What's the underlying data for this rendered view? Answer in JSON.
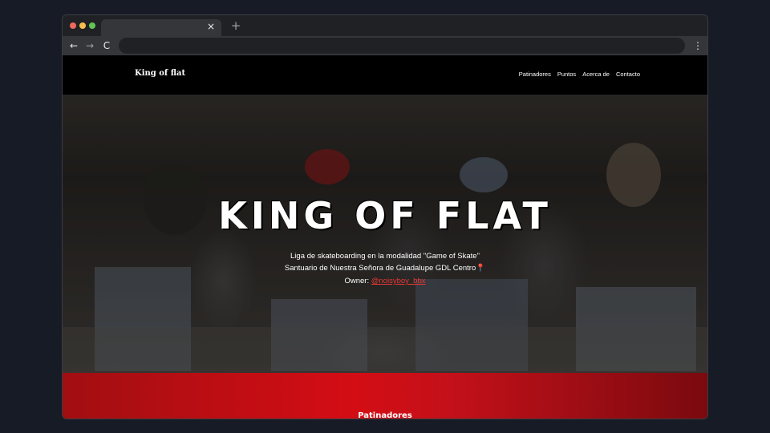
{
  "browser": {
    "tab_close": "×",
    "new_tab": "+",
    "back": "←",
    "forward": "→",
    "reload": "C",
    "menu": "⋮"
  },
  "site": {
    "brand": "King of flat",
    "nav": [
      "Patinadores",
      "Puntos",
      "Acerca de",
      "Contacto"
    ]
  },
  "hero": {
    "title": "KING OF FLAT",
    "line1": "Liga de skateboarding en la modalidad \"Game of Skate\"",
    "line2": "Santuario de Nuestra Señora de Guadalupe GDL Centro",
    "line2_icon": "📍",
    "owner_label": "Owner: ",
    "owner_handle": "@noisyboy_bbx"
  },
  "section": {
    "title": "Patinadores"
  },
  "colors": {
    "accent_red": "#d40d14",
    "link_red": "#e53935"
  }
}
